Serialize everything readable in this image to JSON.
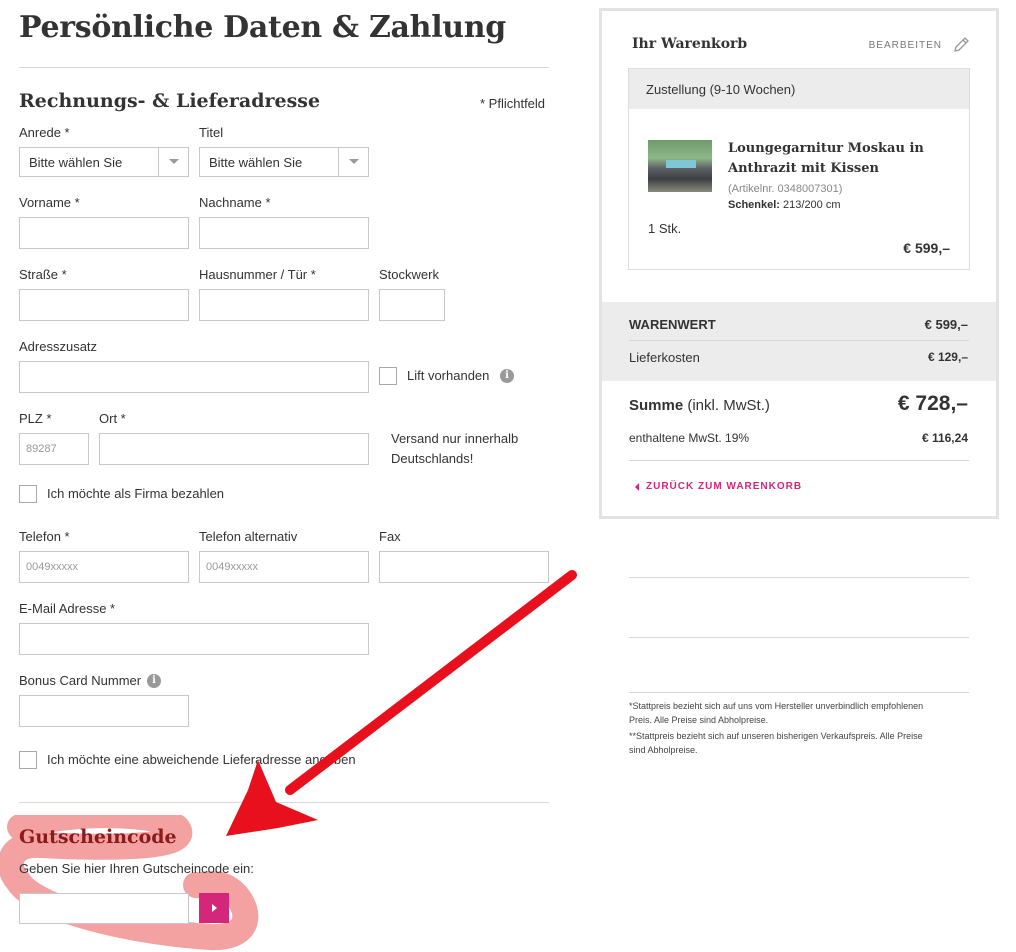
{
  "page_title": "Persönliche Daten & Zahlung",
  "address": {
    "heading": "Rechnungs- & Lieferadresse",
    "required_note": "* Pflichtfeld",
    "anrede_label": "Anrede *",
    "anrede_value": "Bitte wählen Sie",
    "titel_label": "Titel",
    "titel_value": "Bitte wählen Sie",
    "vorname_label": "Vorname *",
    "nachname_label": "Nachname *",
    "strasse_label": "Straße *",
    "hausnummer_label": "Hausnummer / Tür *",
    "stockwerk_label": "Stockwerk",
    "adresszusatz_label": "Adresszusatz",
    "lift_label": "Lift vorhanden",
    "plz_label": "PLZ *",
    "plz_placeholder": "89287",
    "ort_label": "Ort *",
    "shipping_note_line1": "Versand nur innerhalb",
    "shipping_note_line2": "Deutschlands!",
    "firma_label": "Ich möchte als Firma bezahlen",
    "telefon_label": "Telefon *",
    "telefon_placeholder": "0049xxxxx",
    "telefon_alt_label": "Telefon alternativ",
    "telefon_alt_placeholder": "0049xxxxx",
    "fax_label": "Fax",
    "email_label": "E-Mail Adresse *",
    "bonus_label": "Bonus Card Nummer",
    "abweichend_label": "Ich möchte eine abweichende Lieferadresse angeben"
  },
  "voucher": {
    "heading": "Gutscheincode",
    "prompt": "Geben Sie hier Ihren Gutscheincode ein:"
  },
  "cart": {
    "title": "Ihr Warenkorb",
    "edit_label": "BEARBEITEN",
    "delivery": "Zustellung (9-10 Wochen)",
    "product_name_line1": "Loungegarnitur Moskau in",
    "product_name_line2": "Anthrazit mit Kissen",
    "article_no": "(Artikelnr. 0348007301)",
    "attr_label": "Schenkel:",
    "attr_value": "213/200 cm",
    "quantity": "1 Stk.",
    "item_price": "€ 599,–",
    "warenwert_label": "WARENWERT",
    "warenwert_value": "€ 599,–",
    "lieferkosten_label": "Lieferkosten",
    "lieferkosten_value": "€ 129,–",
    "summe_label": "Summe",
    "summe_suffix": "(inkl. MwSt.)",
    "summe_value": "€ 728,–",
    "mwst_label": "enthaltene MwSt. 19%",
    "mwst_value": "€ 116,24",
    "back_label": "ZURÜCK ZUM WARENKORB"
  },
  "footnotes": {
    "line1": "*Stattpreis bezieht sich auf uns vom Hersteller unverbindlich empfohlenen",
    "line2": "Preis. Alle Preise sind Abholpreise.",
    "line3": "**Stattpreis bezieht sich auf unseren bisherigen Verkaufspreis. Alle Preise",
    "line4": "sind Abholpreise."
  },
  "colors": {
    "accent": "#d4267a",
    "voucher_heading": "#8b1a1a",
    "annotation_red": "#e8101c",
    "highlight": "#f08a8a"
  },
  "icons": {
    "edit": "pencil-icon",
    "info": "info-icon",
    "back": "chevron-left-icon",
    "submit": "chevron-right-icon"
  }
}
